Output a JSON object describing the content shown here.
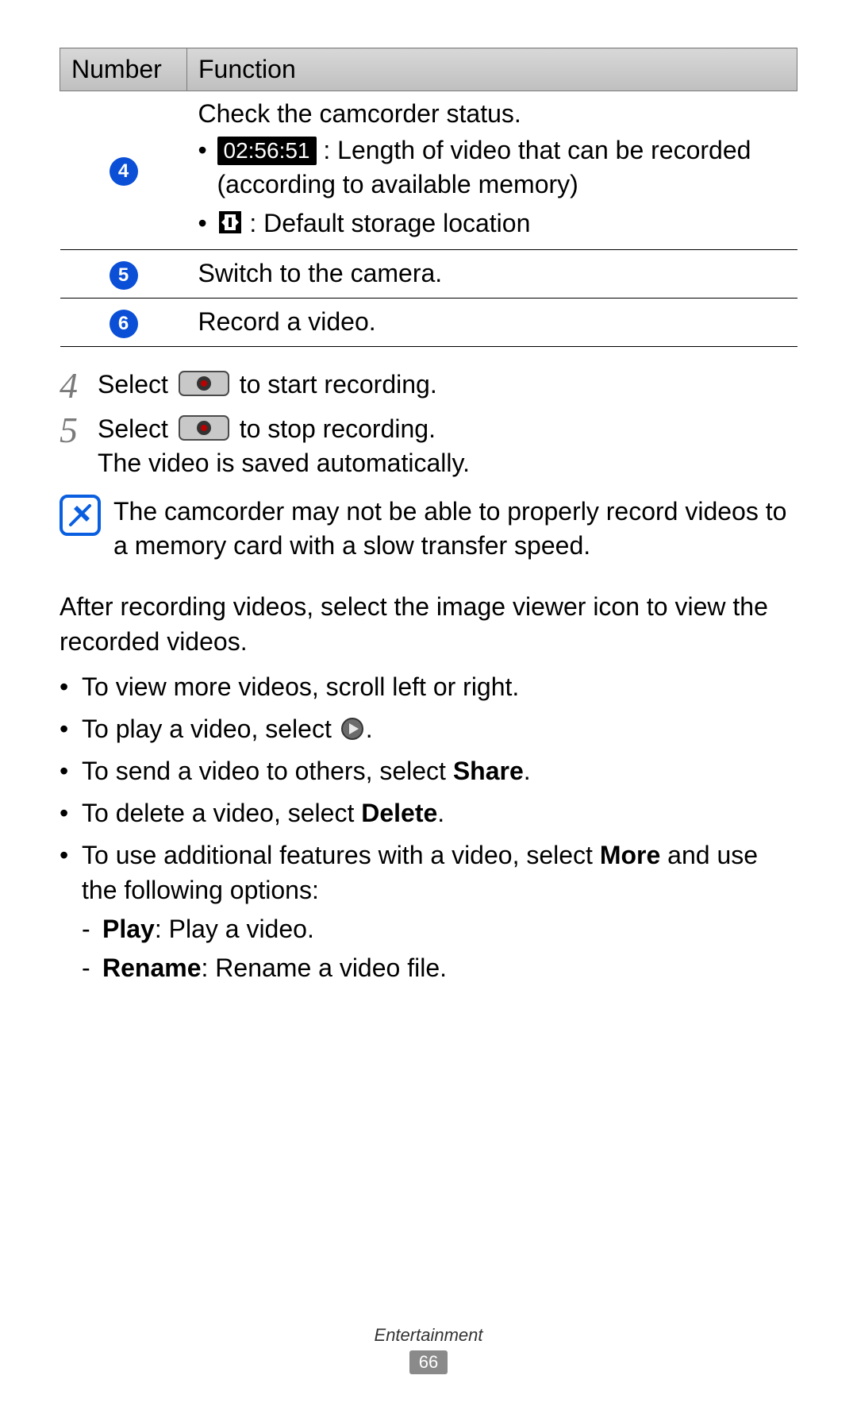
{
  "table": {
    "header_number": "Number",
    "header_function": "Function",
    "rows": [
      {
        "num": "4",
        "title": "Check the camcorder status.",
        "time_badge": "02:56:51",
        "time_desc": " : Length of video that can be recorded (according to available memory)",
        "storage_desc": " : Default storage location"
      },
      {
        "num": "5",
        "title": "Switch to the camera."
      },
      {
        "num": "6",
        "title": "Record a video."
      }
    ]
  },
  "steps": {
    "s4": {
      "num": "4",
      "a": "Select ",
      "b": " to start recording."
    },
    "s5": {
      "num": "5",
      "a": "Select ",
      "b": " to stop recording.",
      "c": "The video is saved automatically."
    }
  },
  "note": "The camcorder may not be able to properly record videos to a memory card with a slow transfer speed.",
  "after_para": "After recording videos, select the image viewer icon to view the recorded videos.",
  "bullets": {
    "b1": "To view more videos, scroll left or right.",
    "b2a": "To play a video, select ",
    "b2b": ".",
    "b3a": "To send a video to others, select ",
    "b3bold": "Share",
    "b3b": ".",
    "b4a": "To delete a video, select ",
    "b4bold": "Delete",
    "b4b": ".",
    "b5a": "To use additional features with a video, select ",
    "b5bold": "More",
    "b5b": " and use the following options:",
    "sub": {
      "p1bold": "Play",
      "p1": ": Play a video.",
      "p2bold": "Rename",
      "p2": ": Rename a video file."
    }
  },
  "footer": {
    "category": "Entertainment",
    "page": "66"
  }
}
